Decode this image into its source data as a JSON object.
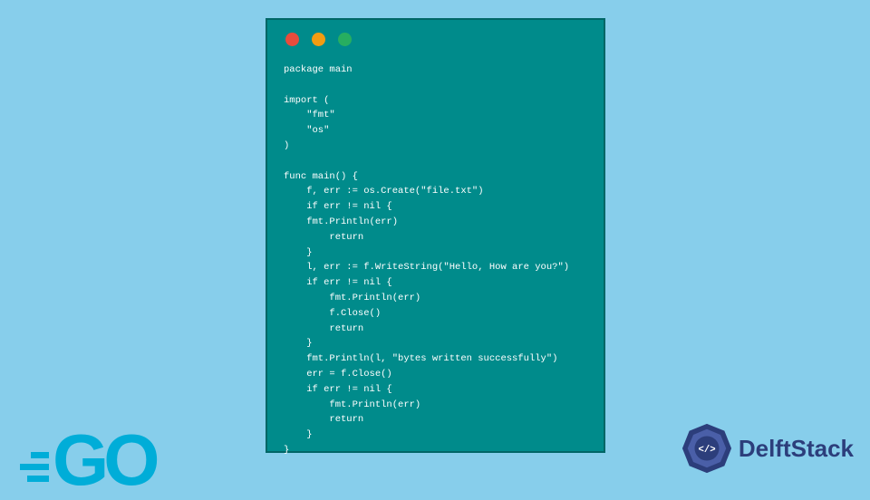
{
  "window": {
    "code": "package main\n\nimport (\n    \"fmt\"\n    \"os\"\n)\n\nfunc main() {\n    f, err := os.Create(\"file.txt\")\n    if err != nil {\n    fmt.Println(err)\n        return\n    }\n    l, err := f.WriteString(\"Hello, How are you?\")\n    if err != nil {\n        fmt.Println(err)\n        f.Close()\n        return\n    }\n    fmt.Println(l, \"bytes written successfully\")\n    err = f.Close()\n    if err != nil {\n        fmt.Println(err)\n        return\n    }\n}"
  },
  "logos": {
    "go": "GO",
    "delft": "DelftStack"
  },
  "colors": {
    "page_bg": "#87CEEB",
    "window_bg": "#008B8B",
    "go_brand": "#00ADD8",
    "delft_brand": "#2C3E7B"
  }
}
